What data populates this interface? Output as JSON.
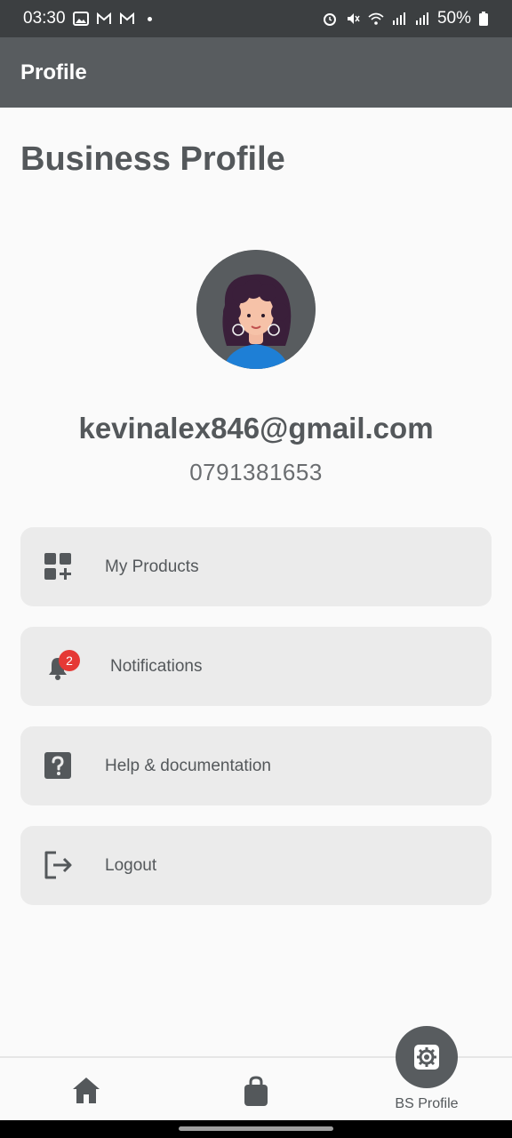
{
  "status_bar": {
    "time": "03:30",
    "battery": "50%"
  },
  "app_bar": {
    "title": "Profile"
  },
  "page": {
    "title": "Business Profile"
  },
  "profile": {
    "email": "kevinalex846@gmail.com",
    "phone": "0791381653"
  },
  "menu": {
    "items": [
      {
        "label": "My Products",
        "icon": "grid-add-icon"
      },
      {
        "label": "Notifications",
        "icon": "bell-icon",
        "badge": "2"
      },
      {
        "label": "Help & documentation",
        "icon": "help-icon"
      },
      {
        "label": "Logout",
        "icon": "logout-icon"
      }
    ]
  },
  "bottom_nav": {
    "items": [
      {
        "icon": "home-icon"
      },
      {
        "icon": "shopping-bag-icon"
      },
      {
        "icon": "settings-icon",
        "label": "BS Profile",
        "active": true
      }
    ]
  },
  "colors": {
    "status_bar": "#3c3f41",
    "app_bar": "#585c5f",
    "text": "#54585b",
    "card": "#ebebeb",
    "badge": "#e53935"
  }
}
